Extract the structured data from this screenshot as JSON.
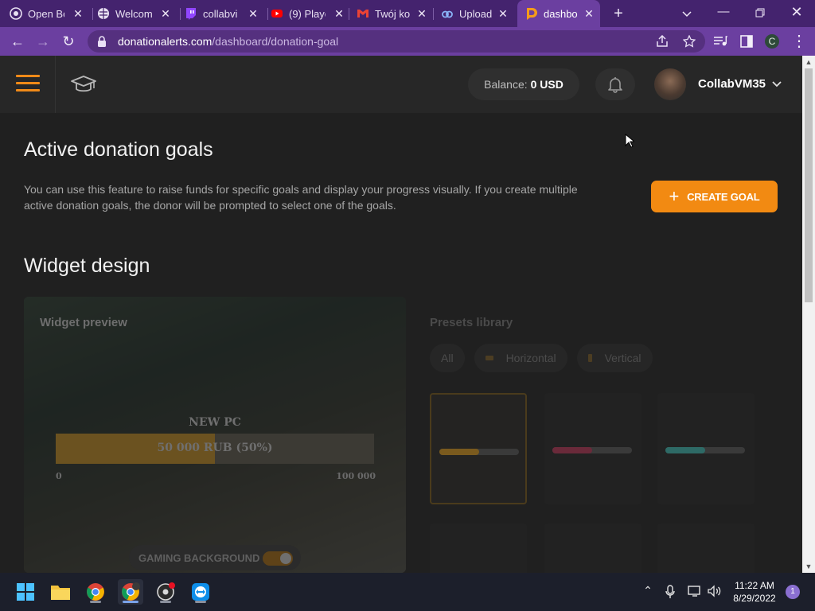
{
  "browser": {
    "tabs": [
      {
        "label": "Open Bo",
        "icon": "obs-icon"
      },
      {
        "label": "Welcom",
        "icon": "globe-icon"
      },
      {
        "label": "collabvi",
        "icon": "twitch-icon"
      },
      {
        "label": "(9) Playe",
        "icon": "youtube-icon"
      },
      {
        "label": "Twój ko",
        "icon": "gmail-icon"
      },
      {
        "label": "Upload",
        "icon": "upload-icon"
      },
      {
        "label": "dashbo",
        "icon": "donationalerts-icon"
      }
    ],
    "url_host": "donationalerts.com",
    "url_path": "/dashboard/donation-goal",
    "profile_initial": "C"
  },
  "header": {
    "balance_label": "Balance:",
    "balance_value": "0 USD",
    "username": "CollabVM35"
  },
  "main": {
    "title": "Active donation goals",
    "description": "You can use this feature to raise funds for specific goals and display your progress visually. If you create multiple active donation goals, the donor will be prompted to select one of the goals.",
    "create_goal_label": "CREATE GOAL",
    "widget_title": "Widget design",
    "preview": {
      "title": "Widget preview",
      "goal_name": "NEW PC",
      "goal_amount": "50 000 RUB (50%)",
      "progress": 0.5,
      "min_label": "0",
      "max_label": "100 000",
      "background_toggle": "GAMING BACKGROUND"
    },
    "presets": {
      "title": "Presets library",
      "filters": [
        "All",
        "Horizontal",
        "Vertical"
      ],
      "items": [
        {
          "color": "#7a5a1e",
          "progress": 0.5
        },
        {
          "color": "#6a2a3a",
          "progress": 0.5
        },
        {
          "color": "#2e6a66",
          "progress": 0.5
        }
      ]
    }
  },
  "taskbar": {
    "time": "11:22 AM",
    "date": "8/29/2022",
    "notification_count": "1"
  }
}
